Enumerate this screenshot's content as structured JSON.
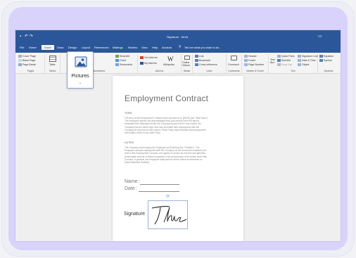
{
  "window": {
    "title": "Signature - Word",
    "search_hint": "Tell me what you want to do"
  },
  "tabs": [
    "File",
    "Home",
    "Insert",
    "Draw",
    "Design",
    "Layout",
    "References",
    "Mailings",
    "Review",
    "View",
    "Help",
    "Acrobat"
  ],
  "active_tab": "Insert",
  "ribbon": {
    "pages": {
      "label": "Pages",
      "items": [
        "Cover Page",
        "Blank Page",
        "Page Break"
      ]
    },
    "tables": {
      "label": "Tables",
      "items": [
        "Table"
      ]
    },
    "illustrations": {
      "label": "Illustrations",
      "items": [
        "SmartArt",
        "Chart",
        "Screenshot"
      ]
    },
    "addins": {
      "label": "Add-ins",
      "items": [
        "Get Add-ins",
        "My Add-ins",
        "Wikipedia"
      ]
    },
    "media": {
      "label": "Media",
      "items": [
        "Online Videos"
      ]
    },
    "links": {
      "label": "Links",
      "items": [
        "Link",
        "Bookmark",
        "Cross-reference"
      ]
    },
    "comments": {
      "label": "Comments",
      "items": [
        "Comment"
      ]
    },
    "header_footer": {
      "label": "Header & Footer",
      "items": [
        "Header",
        "Footer",
        "Page Number"
      ]
    },
    "text": {
      "label": "Text",
      "items": [
        "Text Box",
        "Quick Parts",
        "WordArt",
        "Drop Cap",
        "Signature Line",
        "Date & Time",
        "Object"
      ]
    },
    "symbols": {
      "label": "Symbols",
      "items": [
        "Equation",
        "Symbol"
      ]
    }
  },
  "pictures_button": {
    "label": "Pictures",
    "chevron": "⌄"
  },
  "document": {
    "title": "Employment Contract",
    "section1_heading": "TERM",
    "section1_text": "The term of this Employment Contract shall commence on [DATE] (the \"Start Date\"). The Employee agrees and acknowledges that, just as they have the right to terminate their employment with the Company at any time for any reason, the Company has the same right, and may terminate their employment with the Company at any time for any reason. Either Party may terminate said employment with written notice to the other Party.",
    "section2_heading": "DUTIES",
    "section2_text": "The Company shall employ the Employee as [Position] (the \"Position\"). The Employee accepts employment with the Company on the terms and conditions set forth in this Employment Contract, and agrees to devote his full time and attention (reasonable periods of illness excepted) to the performance of his duties under this Contract. In general, the Employee shall perform all the duties as described on [Insert attached Position].",
    "name_label": "Name :",
    "date_label": "Date :",
    "signature_label": "Signature"
  },
  "colors": {
    "accent": "#2b579a",
    "frame": "#d9d3fb",
    "selection": "#9bb3d6"
  }
}
